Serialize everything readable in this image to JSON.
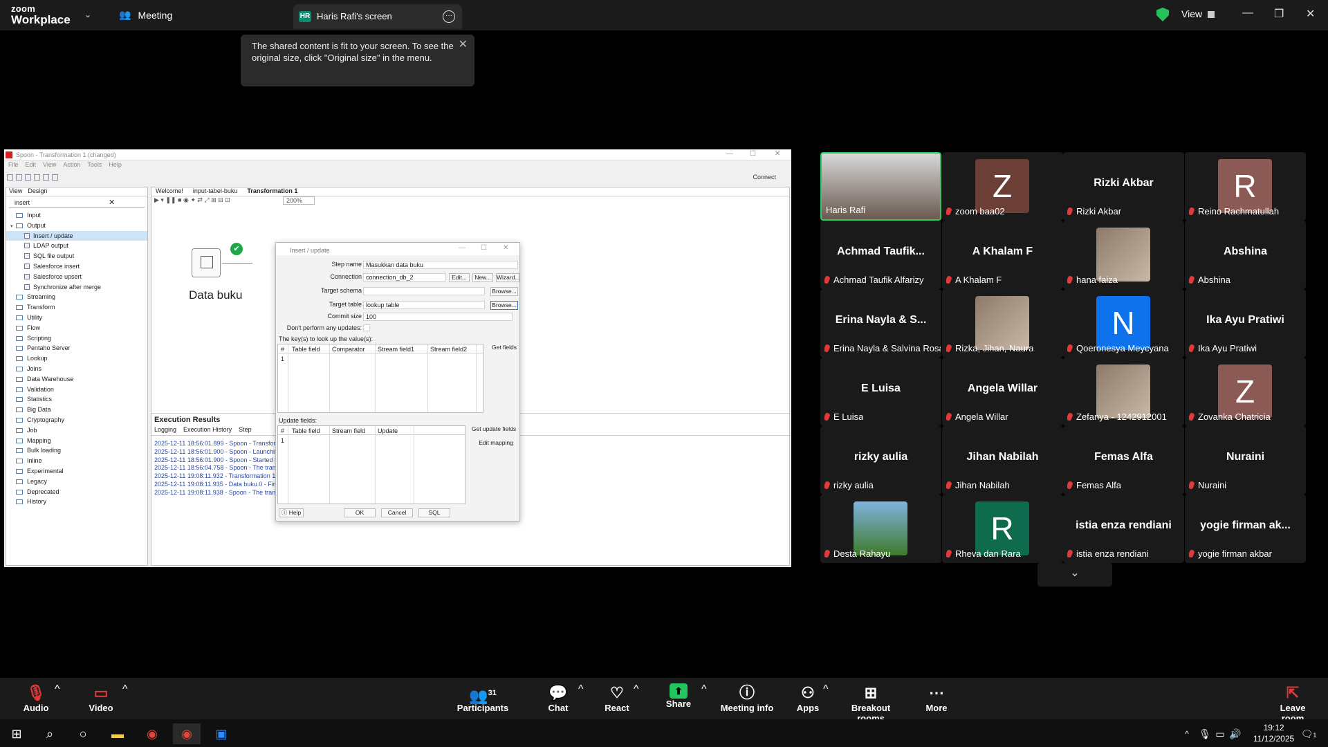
{
  "zoom": {
    "logo_line1": "zoom",
    "logo_line2": "Workplace",
    "meeting_label": "Meeting",
    "share_tab_initials": "HR",
    "share_tab_title": "Haris Rafi's screen",
    "view_label": "View",
    "tooltip": "The shared content is fit to your screen. To see the original size, click \"Original size\" in the menu.",
    "accent": "#23d160",
    "mute_color": "#e23a3a"
  },
  "spoon": {
    "window_title": "Spoon - Transformation 1 (changed)",
    "menu": [
      "File",
      "Edit",
      "View",
      "Action",
      "Tools",
      "Help"
    ],
    "connect": "Connect",
    "left_tabs": [
      "View",
      "Design"
    ],
    "search_value": "insert",
    "tree": [
      {
        "label": "Input",
        "type": "folder",
        "depth": 0
      },
      {
        "label": "Output",
        "type": "folder-open",
        "depth": 0
      },
      {
        "label": "Insert / update",
        "type": "leaf",
        "depth": 1,
        "selected": true
      },
      {
        "label": "LDAP output",
        "type": "leaf",
        "depth": 1
      },
      {
        "label": "SQL file output",
        "type": "leaf",
        "depth": 1
      },
      {
        "label": "Salesforce insert",
        "type": "leaf",
        "depth": 1
      },
      {
        "label": "Salesforce upsert",
        "type": "leaf",
        "depth": 1
      },
      {
        "label": "Synchronize after merge",
        "type": "leaf",
        "depth": 1
      },
      {
        "label": "Streaming",
        "type": "folder",
        "depth": 0
      },
      {
        "label": "Transform",
        "type": "folder",
        "depth": 0
      },
      {
        "label": "Utility",
        "type": "folder",
        "depth": 0
      },
      {
        "label": "Flow",
        "type": "folder",
        "depth": 0
      },
      {
        "label": "Scripting",
        "type": "folder",
        "depth": 0
      },
      {
        "label": "Pentaho Server",
        "type": "folder",
        "depth": 0
      },
      {
        "label": "Lookup",
        "type": "folder",
        "depth": 0
      },
      {
        "label": "Joins",
        "type": "folder",
        "depth": 0
      },
      {
        "label": "Data Warehouse",
        "type": "folder",
        "depth": 0
      },
      {
        "label": "Validation",
        "type": "folder",
        "depth": 0
      },
      {
        "label": "Statistics",
        "type": "folder",
        "depth": 0
      },
      {
        "label": "Big Data",
        "type": "folder",
        "depth": 0
      },
      {
        "label": "Cryptography",
        "type": "folder",
        "depth": 0
      },
      {
        "label": "Job",
        "type": "folder",
        "depth": 0
      },
      {
        "label": "Mapping",
        "type": "folder",
        "depth": 0
      },
      {
        "label": "Bulk loading",
        "type": "folder",
        "depth": 0
      },
      {
        "label": "Inline",
        "type": "folder",
        "depth": 0
      },
      {
        "label": "Experimental",
        "type": "folder",
        "depth": 0
      },
      {
        "label": "Legacy",
        "type": "folder",
        "depth": 0
      },
      {
        "label": "Deprecated",
        "type": "folder",
        "depth": 0
      },
      {
        "label": "History",
        "type": "folder",
        "depth": 0
      }
    ],
    "editor_tabs": [
      "Welcome!",
      "input-tabel-buku",
      "Transformation 1"
    ],
    "zoom_level": "200%",
    "step_name": "Data buku",
    "exec_title": "Execution Results",
    "exec_tabs": [
      "Logging",
      "Execution History",
      "Step"
    ],
    "logs": [
      "2025-12-11 18:56:01.899 - Spoon - Transform",
      "2025-12-11 18:56:01.900 - Spoon - Launching",
      "2025-12-11 18:56:01.900 - Spoon - Started th",
      "2025-12-11 18:56:04.758 - Spoon - The transf",
      "2025-12-11 19:08:11.932 - Transformation 1 -",
      "2025-12-11 19:08:11.935 - Data buku.0 - Finis",
      "2025-12-11 19:08:11.938 - Spoon - The transf"
    ]
  },
  "dialog": {
    "title": "Insert / update",
    "step_name_label": "Step name",
    "step_name_value": "Masukkan data buku",
    "connection_label": "Connection",
    "connection_value": "connection_db_2",
    "edit_btn": "Edit...",
    "new_btn": "New...",
    "wizard_btn": "Wizard...",
    "target_schema_label": "Target schema",
    "browse_btn": "Browse...",
    "target_table_label": "Target table",
    "target_table_value": "lookup table",
    "commit_size_label": "Commit size",
    "commit_size_value": "100",
    "dont_update_label": "Don't perform any updates:",
    "keys_label": "The key(s) to look up the value(s):",
    "keys_headers": [
      "#",
      "Table field",
      "Comparator",
      "Stream field1",
      "Stream field2"
    ],
    "row_num": "1",
    "get_fields_btn": "Get fields",
    "update_fields_label": "Update fields:",
    "update_headers": [
      "#",
      "Table field",
      "Stream field",
      "Update"
    ],
    "get_update_fields_btn": "Get update fields",
    "edit_mapping_btn": "Edit mapping",
    "help_btn": "Help",
    "ok_btn": "OK",
    "cancel_btn": "Cancel",
    "sql_btn": "SQL"
  },
  "participants": [
    {
      "tile": "Haris Rafi",
      "name": "Haris Rafi",
      "kind": "video"
    },
    {
      "tile": "Z",
      "name": "zoom baa02",
      "kind": "avatar",
      "color": "#6b3e36"
    },
    {
      "tile": "Rizki Akbar",
      "name": "Rizki Akbar",
      "kind": "text"
    },
    {
      "tile": "R",
      "name": "Reino Rachmatullah",
      "kind": "avatar",
      "color": "#8b5a55"
    },
    {
      "tile": "Achmad Taufik...",
      "name": "Achmad Taufik Alfarizy",
      "kind": "text"
    },
    {
      "tile": "A Khalam F",
      "name": "A Khalam F",
      "kind": "text"
    },
    {
      "tile": "",
      "name": "hana faiza",
      "kind": "photo"
    },
    {
      "tile": "Abshina",
      "name": "Abshina",
      "kind": "text"
    },
    {
      "tile": "Erina Nayla & S...",
      "name": "Erina Nayla & Salvina Rosal...",
      "kind": "text"
    },
    {
      "tile": "",
      "name": "Rizka, Jihan, Naura",
      "kind": "photo"
    },
    {
      "tile": "N",
      "name": "Qoeronesya Meycyana",
      "kind": "avatar",
      "color": "#0e72ed"
    },
    {
      "tile": "Ika Ayu Pratiwi",
      "name": "Ika Ayu Pratiwi",
      "kind": "text"
    },
    {
      "tile": "E Luisa",
      "name": "E Luisa",
      "kind": "text"
    },
    {
      "tile": "Angela Willar",
      "name": "Angela Willar",
      "kind": "text"
    },
    {
      "tile": "",
      "name": "Zefanya - 1242912001",
      "kind": "photo"
    },
    {
      "tile": "Z",
      "name": "Zovanka Chatricia",
      "kind": "avatar",
      "color": "#8b5a55"
    },
    {
      "tile": "rizky aulia",
      "name": "rizky aulia",
      "kind": "text"
    },
    {
      "tile": "Jihan Nabilah",
      "name": "Jihan Nabilah",
      "kind": "text"
    },
    {
      "tile": "Femas Alfa",
      "name": "Femas Alfa",
      "kind": "text"
    },
    {
      "tile": "Nuraini",
      "name": "Nuraini",
      "kind": "text"
    },
    {
      "tile": "",
      "name": "Desta Rahayu",
      "kind": "photo-green"
    },
    {
      "tile": "R",
      "name": "Rheva dan Rara",
      "kind": "avatar",
      "color": "#0e6b4e"
    },
    {
      "tile": "istia enza rendiani",
      "name": "istia enza rendiani",
      "kind": "text"
    },
    {
      "tile": "yogie firman ak...",
      "name": "yogie firman akbar",
      "kind": "text"
    }
  ],
  "toolbar": {
    "audio": "Audio",
    "video": "Video",
    "participants": "Participants",
    "participants_count": "31",
    "chat": "Chat",
    "react": "React",
    "share": "Share",
    "meeting_info": "Meeting info",
    "apps": "Apps",
    "breakout": "Breakout rooms",
    "more": "More",
    "leave": "Leave room"
  },
  "taskbar": {
    "time": "19:12",
    "date": "11/12/2025",
    "notif_count": "1"
  }
}
